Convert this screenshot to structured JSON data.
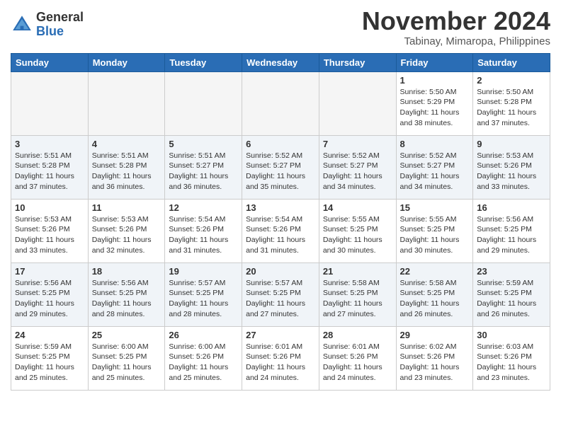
{
  "logo": {
    "general": "General",
    "blue": "Blue"
  },
  "title": "November 2024",
  "subtitle": "Tabinay, Mimaropa, Philippines",
  "weekdays": [
    "Sunday",
    "Monday",
    "Tuesday",
    "Wednesday",
    "Thursday",
    "Friday",
    "Saturday"
  ],
  "weeks": [
    [
      {
        "day": "",
        "info": ""
      },
      {
        "day": "",
        "info": ""
      },
      {
        "day": "",
        "info": ""
      },
      {
        "day": "",
        "info": ""
      },
      {
        "day": "",
        "info": ""
      },
      {
        "day": "1",
        "info": "Sunrise: 5:50 AM\nSunset: 5:29 PM\nDaylight: 11 hours\nand 38 minutes."
      },
      {
        "day": "2",
        "info": "Sunrise: 5:50 AM\nSunset: 5:28 PM\nDaylight: 11 hours\nand 37 minutes."
      }
    ],
    [
      {
        "day": "3",
        "info": "Sunrise: 5:51 AM\nSunset: 5:28 PM\nDaylight: 11 hours\nand 37 minutes."
      },
      {
        "day": "4",
        "info": "Sunrise: 5:51 AM\nSunset: 5:28 PM\nDaylight: 11 hours\nand 36 minutes."
      },
      {
        "day": "5",
        "info": "Sunrise: 5:51 AM\nSunset: 5:27 PM\nDaylight: 11 hours\nand 36 minutes."
      },
      {
        "day": "6",
        "info": "Sunrise: 5:52 AM\nSunset: 5:27 PM\nDaylight: 11 hours\nand 35 minutes."
      },
      {
        "day": "7",
        "info": "Sunrise: 5:52 AM\nSunset: 5:27 PM\nDaylight: 11 hours\nand 34 minutes."
      },
      {
        "day": "8",
        "info": "Sunrise: 5:52 AM\nSunset: 5:27 PM\nDaylight: 11 hours\nand 34 minutes."
      },
      {
        "day": "9",
        "info": "Sunrise: 5:53 AM\nSunset: 5:26 PM\nDaylight: 11 hours\nand 33 minutes."
      }
    ],
    [
      {
        "day": "10",
        "info": "Sunrise: 5:53 AM\nSunset: 5:26 PM\nDaylight: 11 hours\nand 33 minutes."
      },
      {
        "day": "11",
        "info": "Sunrise: 5:53 AM\nSunset: 5:26 PM\nDaylight: 11 hours\nand 32 minutes."
      },
      {
        "day": "12",
        "info": "Sunrise: 5:54 AM\nSunset: 5:26 PM\nDaylight: 11 hours\nand 31 minutes."
      },
      {
        "day": "13",
        "info": "Sunrise: 5:54 AM\nSunset: 5:26 PM\nDaylight: 11 hours\nand 31 minutes."
      },
      {
        "day": "14",
        "info": "Sunrise: 5:55 AM\nSunset: 5:25 PM\nDaylight: 11 hours\nand 30 minutes."
      },
      {
        "day": "15",
        "info": "Sunrise: 5:55 AM\nSunset: 5:25 PM\nDaylight: 11 hours\nand 30 minutes."
      },
      {
        "day": "16",
        "info": "Sunrise: 5:56 AM\nSunset: 5:25 PM\nDaylight: 11 hours\nand 29 minutes."
      }
    ],
    [
      {
        "day": "17",
        "info": "Sunrise: 5:56 AM\nSunset: 5:25 PM\nDaylight: 11 hours\nand 29 minutes."
      },
      {
        "day": "18",
        "info": "Sunrise: 5:56 AM\nSunset: 5:25 PM\nDaylight: 11 hours\nand 28 minutes."
      },
      {
        "day": "19",
        "info": "Sunrise: 5:57 AM\nSunset: 5:25 PM\nDaylight: 11 hours\nand 28 minutes."
      },
      {
        "day": "20",
        "info": "Sunrise: 5:57 AM\nSunset: 5:25 PM\nDaylight: 11 hours\nand 27 minutes."
      },
      {
        "day": "21",
        "info": "Sunrise: 5:58 AM\nSunset: 5:25 PM\nDaylight: 11 hours\nand 27 minutes."
      },
      {
        "day": "22",
        "info": "Sunrise: 5:58 AM\nSunset: 5:25 PM\nDaylight: 11 hours\nand 26 minutes."
      },
      {
        "day": "23",
        "info": "Sunrise: 5:59 AM\nSunset: 5:25 PM\nDaylight: 11 hours\nand 26 minutes."
      }
    ],
    [
      {
        "day": "24",
        "info": "Sunrise: 5:59 AM\nSunset: 5:25 PM\nDaylight: 11 hours\nand 25 minutes."
      },
      {
        "day": "25",
        "info": "Sunrise: 6:00 AM\nSunset: 5:25 PM\nDaylight: 11 hours\nand 25 minutes."
      },
      {
        "day": "26",
        "info": "Sunrise: 6:00 AM\nSunset: 5:26 PM\nDaylight: 11 hours\nand 25 minutes."
      },
      {
        "day": "27",
        "info": "Sunrise: 6:01 AM\nSunset: 5:26 PM\nDaylight: 11 hours\nand 24 minutes."
      },
      {
        "day": "28",
        "info": "Sunrise: 6:01 AM\nSunset: 5:26 PM\nDaylight: 11 hours\nand 24 minutes."
      },
      {
        "day": "29",
        "info": "Sunrise: 6:02 AM\nSunset: 5:26 PM\nDaylight: 11 hours\nand 23 minutes."
      },
      {
        "day": "30",
        "info": "Sunrise: 6:03 AM\nSunset: 5:26 PM\nDaylight: 11 hours\nand 23 minutes."
      }
    ]
  ]
}
